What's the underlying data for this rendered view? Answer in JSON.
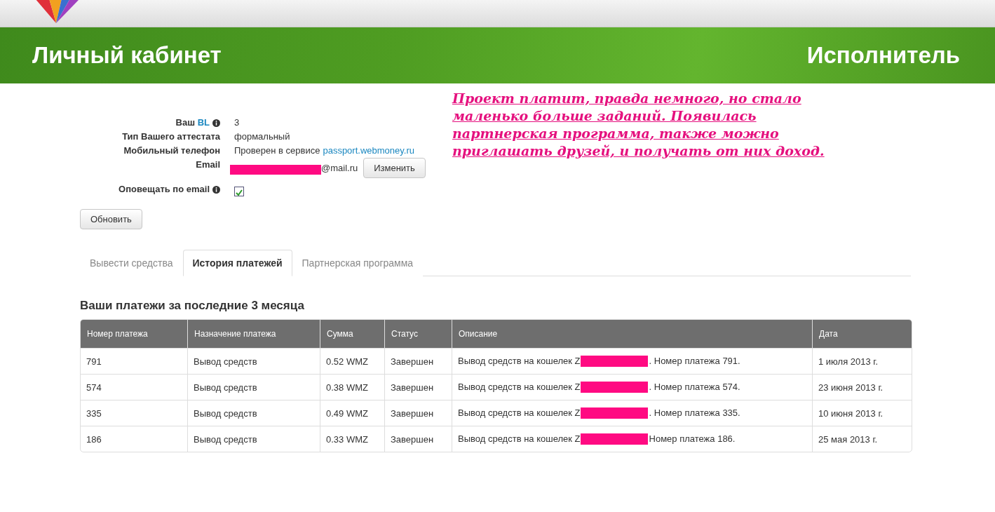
{
  "banner": {
    "title": "Личный кабинет",
    "role": "Исполнитель"
  },
  "profile": {
    "fields": [
      {
        "kind": "bl",
        "label": "Ваш",
        "label_accent": "BL",
        "info": true,
        "value": "3"
      },
      {
        "kind": "text",
        "label": "Тип Вашего аттестата",
        "info": false,
        "value": "формальный"
      },
      {
        "kind": "link",
        "label": "Мобильный телефон",
        "info": false,
        "value": "Проверен в сервисе",
        "link": "passport.webmoney.ru"
      },
      {
        "kind": "email",
        "label": "Email",
        "info": false,
        "value": "@mail.ru",
        "button": "Изменить"
      },
      {
        "kind": "checkbox",
        "label": "Оповещать по email",
        "info": true,
        "checked": true
      }
    ],
    "submit": "Обновить"
  },
  "annotation": {
    "lines": [
      "Проект платит, правда немного, но стало",
      "маленько больше заданий. Появилась",
      "партнерская программа, также можно",
      "приглашать друзей, и получать от них доход."
    ]
  },
  "tabs": [
    {
      "label": "Вывести средства",
      "selected": false
    },
    {
      "label": "История платежей",
      "selected": true
    },
    {
      "label": "Партнерская программа",
      "selected": false
    }
  ],
  "payments": {
    "heading": "Ваши платежи за последние 3 месяца",
    "columns": [
      "Номер платежа",
      "Назначение платежа",
      "Сумма",
      "Статус",
      "Описание",
      "Дата"
    ],
    "rows": [
      {
        "number": "791",
        "purpose": "Вывод средств",
        "amount": "0.52 WMZ",
        "status": "Завершен",
        "desc_before": "Вывод средств на кошелек Z",
        "desc_after": ". Номер платежа 791.",
        "date": "1 июля 2013 г."
      },
      {
        "number": "574",
        "purpose": "Вывод средств",
        "amount": "0.38 WMZ",
        "status": "Завершен",
        "desc_before": "Вывод средств на кошелек Z",
        "desc_after": ". Номер платежа 574.",
        "date": "23 июня 2013 г."
      },
      {
        "number": "335",
        "purpose": "Вывод средств",
        "amount": "0.49 WMZ",
        "status": "Завершен",
        "desc_before": "Вывод средств на кошелек Z",
        "desc_after": ". Номер платежа 335.",
        "date": "10 июня 2013 г."
      },
      {
        "number": "186",
        "purpose": "Вывод средств",
        "amount": "0.33 WMZ",
        "status": "Завершен",
        "desc_before": "Вывод средств на кошелек Z",
        "desc_after": "Номер платежа 186.",
        "date": "25 мая 2013 г."
      }
    ]
  }
}
